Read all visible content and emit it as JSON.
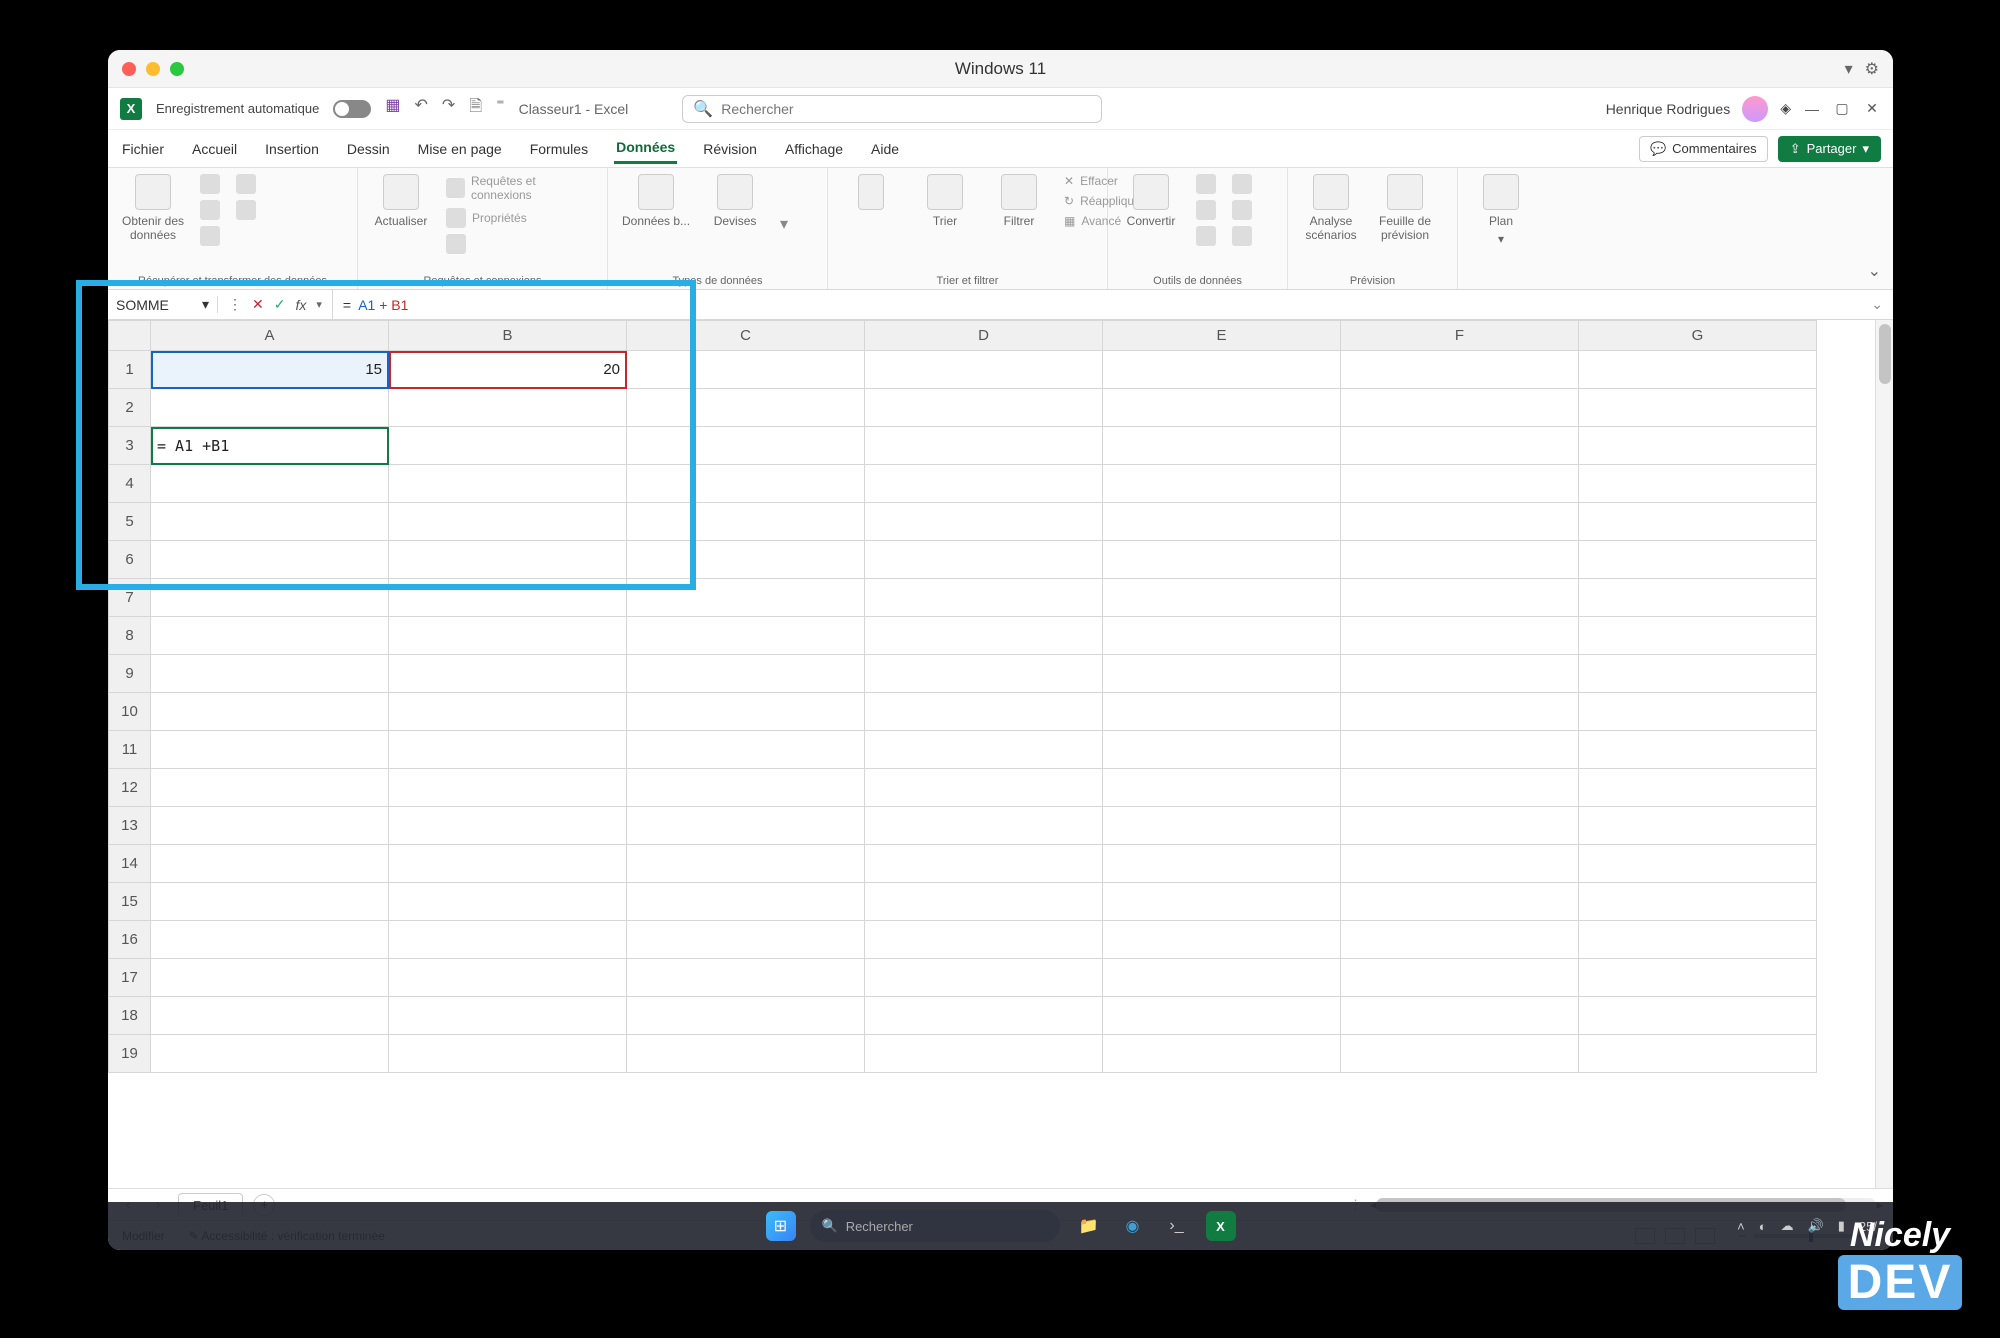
{
  "mac_title": "Windows 11",
  "excel": {
    "autosave_label": "Enregistrement automatique",
    "file_label": "Classeur1  -  Excel",
    "search_placeholder": "Rechercher",
    "user_name": "Henrique Rodrigues",
    "comments_btn": "Commentaires",
    "share_btn": "Partager"
  },
  "tabs": [
    "Fichier",
    "Accueil",
    "Insertion",
    "Dessin",
    "Mise en page",
    "Formules",
    "Données",
    "Révision",
    "Affichage",
    "Aide"
  ],
  "active_tab": "Données",
  "ribbon_groups": {
    "get": {
      "label": "Récupérer et transformer des données",
      "big": "Obtenir des\ndonnées"
    },
    "conn": {
      "label": "Requêtes et connexions",
      "big": "Actualiser",
      "l1": "Requêtes et connexions",
      "l2": "Propriétés",
      "l3": ""
    },
    "types": {
      "label": "Types de données",
      "b1": "Données b...",
      "b2": "Devises"
    },
    "sort": {
      "label": "Trier et filtrer",
      "b1": "Trier",
      "b2": "Filtrer",
      "l1": "Effacer",
      "l2": "Réappliquer",
      "l3": "Avancé"
    },
    "tools": {
      "label": "Outils de données",
      "big": "Convertir"
    },
    "forecast": {
      "label": "Prévision",
      "b1": "Analyse\nscénarios",
      "b2": "Feuille de\nprévision"
    },
    "plan": {
      "label": "",
      "big": "Plan"
    }
  },
  "formula_bar": {
    "name_box": "SOMME",
    "formula_text": "= A1 +B1",
    "eq": "=",
    "ref1": "A1",
    "plus": " +",
    "ref2": "B1"
  },
  "columns": [
    "A",
    "B",
    "C",
    "D",
    "E",
    "F",
    "G"
  ],
  "rows": 19,
  "cells": {
    "A1": "15",
    "B1": "20",
    "A3": "= A1 +B1"
  },
  "sheet_tab": "Feuil1",
  "status": {
    "mode": "Modifier",
    "access": "Accessibilité : vérification terminée"
  },
  "taskbar": {
    "search": "Rechercher",
    "time": "25/"
  },
  "watermark": {
    "l1": "Nicely",
    "l2": "DEV"
  }
}
